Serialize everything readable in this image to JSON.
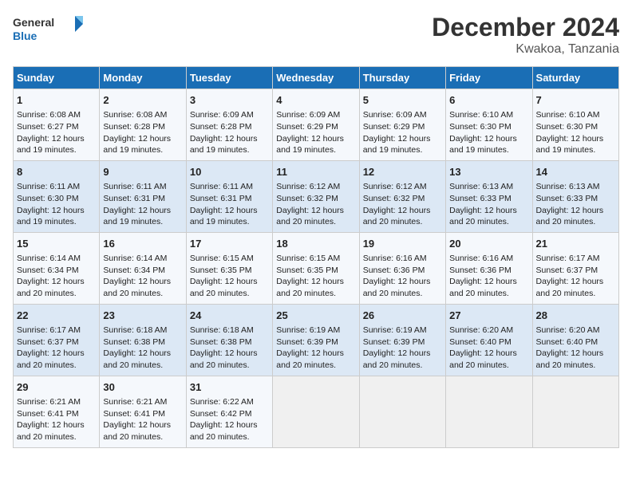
{
  "header": {
    "logo_line1": "General",
    "logo_line2": "Blue",
    "title": "December 2024",
    "subtitle": "Kwakoa, Tanzania"
  },
  "days_of_week": [
    "Sunday",
    "Monday",
    "Tuesday",
    "Wednesday",
    "Thursday",
    "Friday",
    "Saturday"
  ],
  "weeks": [
    [
      {
        "day": "1",
        "sunrise": "6:08 AM",
        "sunset": "6:27 PM",
        "daylight": "12 hours and 19 minutes."
      },
      {
        "day": "2",
        "sunrise": "6:08 AM",
        "sunset": "6:28 PM",
        "daylight": "12 hours and 19 minutes."
      },
      {
        "day": "3",
        "sunrise": "6:09 AM",
        "sunset": "6:28 PM",
        "daylight": "12 hours and 19 minutes."
      },
      {
        "day": "4",
        "sunrise": "6:09 AM",
        "sunset": "6:29 PM",
        "daylight": "12 hours and 19 minutes."
      },
      {
        "day": "5",
        "sunrise": "6:09 AM",
        "sunset": "6:29 PM",
        "daylight": "12 hours and 19 minutes."
      },
      {
        "day": "6",
        "sunrise": "6:10 AM",
        "sunset": "6:30 PM",
        "daylight": "12 hours and 19 minutes."
      },
      {
        "day": "7",
        "sunrise": "6:10 AM",
        "sunset": "6:30 PM",
        "daylight": "12 hours and 19 minutes."
      }
    ],
    [
      {
        "day": "8",
        "sunrise": "6:11 AM",
        "sunset": "6:30 PM",
        "daylight": "12 hours and 19 minutes."
      },
      {
        "day": "9",
        "sunrise": "6:11 AM",
        "sunset": "6:31 PM",
        "daylight": "12 hours and 19 minutes."
      },
      {
        "day": "10",
        "sunrise": "6:11 AM",
        "sunset": "6:31 PM",
        "daylight": "12 hours and 19 minutes."
      },
      {
        "day": "11",
        "sunrise": "6:12 AM",
        "sunset": "6:32 PM",
        "daylight": "12 hours and 20 minutes."
      },
      {
        "day": "12",
        "sunrise": "6:12 AM",
        "sunset": "6:32 PM",
        "daylight": "12 hours and 20 minutes."
      },
      {
        "day": "13",
        "sunrise": "6:13 AM",
        "sunset": "6:33 PM",
        "daylight": "12 hours and 20 minutes."
      },
      {
        "day": "14",
        "sunrise": "6:13 AM",
        "sunset": "6:33 PM",
        "daylight": "12 hours and 20 minutes."
      }
    ],
    [
      {
        "day": "15",
        "sunrise": "6:14 AM",
        "sunset": "6:34 PM",
        "daylight": "12 hours and 20 minutes."
      },
      {
        "day": "16",
        "sunrise": "6:14 AM",
        "sunset": "6:34 PM",
        "daylight": "12 hours and 20 minutes."
      },
      {
        "day": "17",
        "sunrise": "6:15 AM",
        "sunset": "6:35 PM",
        "daylight": "12 hours and 20 minutes."
      },
      {
        "day": "18",
        "sunrise": "6:15 AM",
        "sunset": "6:35 PM",
        "daylight": "12 hours and 20 minutes."
      },
      {
        "day": "19",
        "sunrise": "6:16 AM",
        "sunset": "6:36 PM",
        "daylight": "12 hours and 20 minutes."
      },
      {
        "day": "20",
        "sunrise": "6:16 AM",
        "sunset": "6:36 PM",
        "daylight": "12 hours and 20 minutes."
      },
      {
        "day": "21",
        "sunrise": "6:17 AM",
        "sunset": "6:37 PM",
        "daylight": "12 hours and 20 minutes."
      }
    ],
    [
      {
        "day": "22",
        "sunrise": "6:17 AM",
        "sunset": "6:37 PM",
        "daylight": "12 hours and 20 minutes."
      },
      {
        "day": "23",
        "sunrise": "6:18 AM",
        "sunset": "6:38 PM",
        "daylight": "12 hours and 20 minutes."
      },
      {
        "day": "24",
        "sunrise": "6:18 AM",
        "sunset": "6:38 PM",
        "daylight": "12 hours and 20 minutes."
      },
      {
        "day": "25",
        "sunrise": "6:19 AM",
        "sunset": "6:39 PM",
        "daylight": "12 hours and 20 minutes."
      },
      {
        "day": "26",
        "sunrise": "6:19 AM",
        "sunset": "6:39 PM",
        "daylight": "12 hours and 20 minutes."
      },
      {
        "day": "27",
        "sunrise": "6:20 AM",
        "sunset": "6:40 PM",
        "daylight": "12 hours and 20 minutes."
      },
      {
        "day": "28",
        "sunrise": "6:20 AM",
        "sunset": "6:40 PM",
        "daylight": "12 hours and 20 minutes."
      }
    ],
    [
      {
        "day": "29",
        "sunrise": "6:21 AM",
        "sunset": "6:41 PM",
        "daylight": "12 hours and 20 minutes."
      },
      {
        "day": "30",
        "sunrise": "6:21 AM",
        "sunset": "6:41 PM",
        "daylight": "12 hours and 20 minutes."
      },
      {
        "day": "31",
        "sunrise": "6:22 AM",
        "sunset": "6:42 PM",
        "daylight": "12 hours and 20 minutes."
      },
      null,
      null,
      null,
      null
    ]
  ],
  "labels": {
    "sunrise": "Sunrise:",
    "sunset": "Sunset:",
    "daylight": "Daylight:"
  }
}
